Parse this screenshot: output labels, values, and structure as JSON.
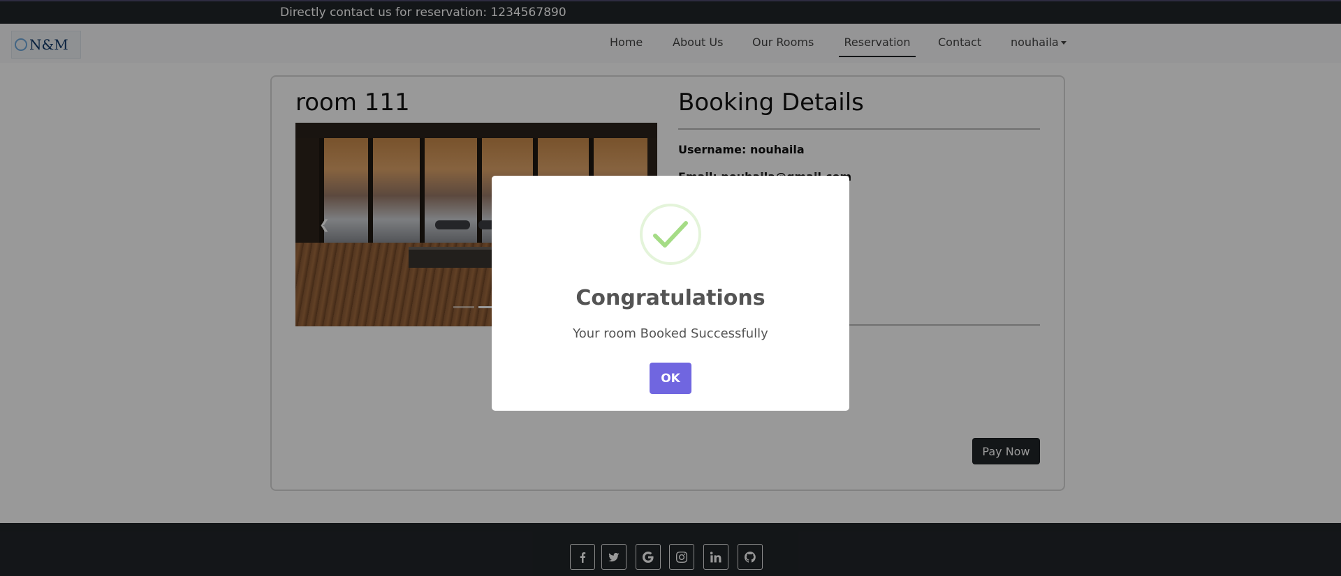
{
  "topbar": {
    "contact_text": "Directly contact us for reservation: 1234567890"
  },
  "navbar": {
    "logo_text": "N&M",
    "items": [
      {
        "label": "Home"
      },
      {
        "label": "About Us"
      },
      {
        "label": "Our Rooms"
      },
      {
        "label": "Reservation",
        "active": true
      },
      {
        "label": "Contact"
      }
    ],
    "user_menu_label": "nouhaila"
  },
  "room": {
    "title": "room 111"
  },
  "booking": {
    "title": "Booking Details",
    "username_line": "Username: nouhaila",
    "email_line": "Email: nouhaila@gmail.com",
    "pay_button_label": "Pay Now"
  },
  "modal": {
    "icon": "success-check-icon",
    "title": "Congratulations",
    "text": "Your room Booked Successfully",
    "ok_label": "OK",
    "accent_color": "#7066e0",
    "check_color": "#a5dc86"
  },
  "footer": {
    "social_icons": [
      "facebook-icon",
      "twitter-icon",
      "google-icon",
      "instagram-icon",
      "linkedin-icon",
      "github-icon"
    ]
  }
}
